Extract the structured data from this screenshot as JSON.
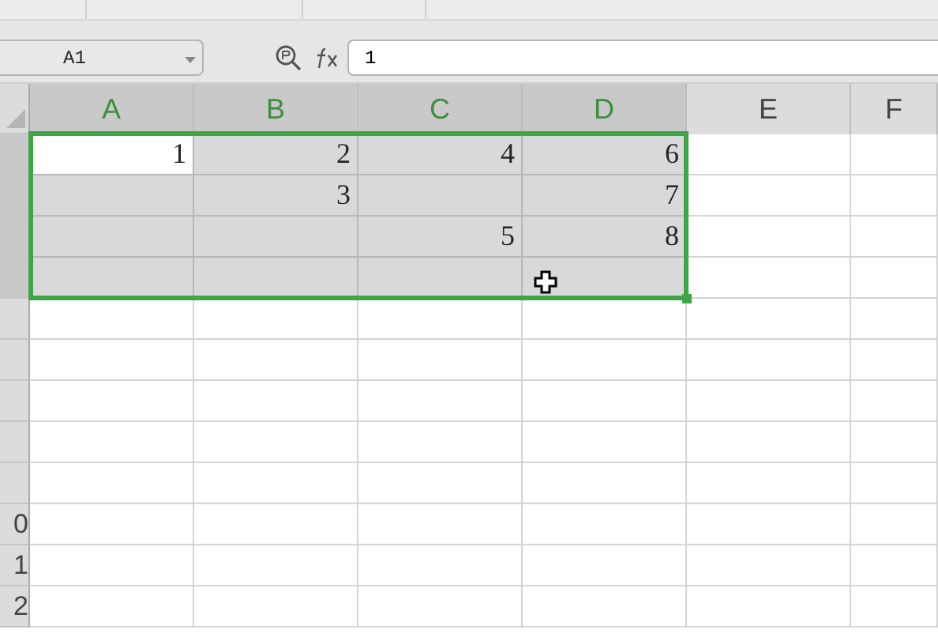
{
  "formula_bar": {
    "name_box": "A1",
    "formula": "1"
  },
  "columns": [
    {
      "label": "A",
      "selected": true
    },
    {
      "label": "B",
      "selected": true
    },
    {
      "label": "C",
      "selected": true
    },
    {
      "label": "D",
      "selected": true
    },
    {
      "label": "E",
      "selected": false
    },
    {
      "label": "F",
      "selected": false
    }
  ],
  "rows": [
    {
      "selected": true,
      "cells": [
        {
          "value": "1",
          "active": true
        },
        {
          "value": "2",
          "active": false
        },
        {
          "value": "4",
          "active": false
        },
        {
          "value": "6",
          "active": false
        }
      ]
    },
    {
      "selected": true,
      "cells": [
        {
          "active": false
        },
        {
          "value": "3",
          "active": false
        },
        {
          "active": false
        },
        {
          "value": "7",
          "active": false
        }
      ]
    },
    {
      "selected": true,
      "cells": [
        {
          "active": false
        },
        {
          "active": false
        },
        {
          "value": "5",
          "active": false
        },
        {
          "value": "8",
          "active": false
        }
      ]
    },
    {
      "selected": true,
      "cells": [
        {
          "active": false
        },
        {
          "active": false
        },
        {
          "active": false
        },
        {
          "active": false
        }
      ]
    },
    {
      "selected": false
    },
    {
      "selected": false
    },
    {
      "selected": false
    },
    {
      "selected": false
    },
    {
      "selected": false
    },
    {
      "selected": false,
      "header": "0"
    },
    {
      "selected": false,
      "header": "1"
    },
    {
      "selected": false,
      "header": "2"
    }
  ]
}
